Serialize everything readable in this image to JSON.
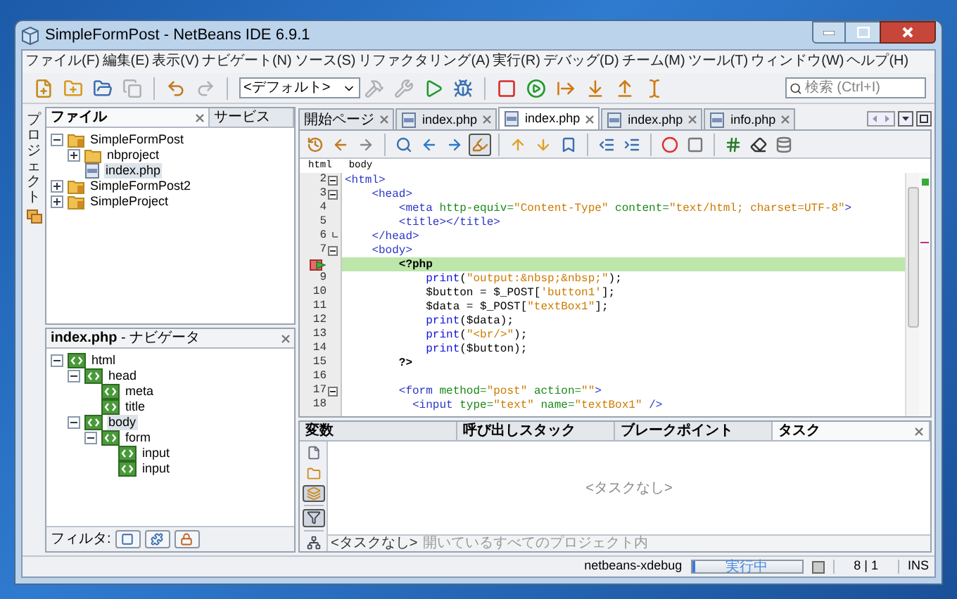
{
  "window": {
    "title": "SimpleFormPost - NetBeans IDE 6.9.1"
  },
  "menu": [
    "ファイル(F)",
    "編集(E)",
    "表示(V)",
    "ナビゲート(N)",
    "ソース(S)",
    "リファクタリング(A)",
    "実行(R)",
    "デバッグ(D)",
    "チーム(M)",
    "ツール(T)",
    "ウィンドウ(W)",
    "ヘルプ(H)"
  ],
  "toolbar": [
    {
      "kind": "new-file",
      "disabled": false
    },
    {
      "kind": "new-project",
      "disabled": false
    },
    {
      "kind": "open-project",
      "disabled": false
    },
    {
      "kind": "close-project",
      "disabled": true
    },
    {
      "kind": "separator",
      "disabled": false
    },
    {
      "kind": "undo",
      "disabled": false
    },
    {
      "kind": "redo",
      "disabled": true
    },
    {
      "kind": "separator",
      "disabled": false
    },
    {
      "kind": "config",
      "disabled": false
    },
    {
      "kind": "build",
      "disabled": true
    },
    {
      "kind": "clean-build",
      "disabled": true
    },
    {
      "kind": "run",
      "disabled": false
    },
    {
      "kind": "debug",
      "disabled": false
    },
    {
      "kind": "separator",
      "disabled": false
    },
    {
      "kind": "stop",
      "disabled": false
    },
    {
      "kind": "continue",
      "disabled": false
    },
    {
      "kind": "step-over",
      "disabled": false
    },
    {
      "kind": "step-into",
      "disabled": false
    },
    {
      "kind": "step-out",
      "disabled": false
    },
    {
      "kind": "run-to-cursor",
      "disabled": false
    }
  ],
  "config_combo": {
    "value": "<デフォルト>"
  },
  "search": {
    "placeholder": "検索 (Ctrl+I)"
  },
  "side_strip": {
    "label": "プロジェクト"
  },
  "files_panel": {
    "tabs": [
      {
        "label": "ファイル",
        "selected": true
      },
      {
        "label": "サービス",
        "selected": false
      }
    ],
    "tree": [
      {
        "label": "SimpleFormPost",
        "kind": "project",
        "expanded": true,
        "selected": false,
        "children": [
          {
            "label": "nbproject",
            "kind": "folder",
            "expanded": false,
            "selected": false
          },
          {
            "label": "index.php",
            "kind": "php",
            "selected": true
          }
        ]
      },
      {
        "label": "SimpleFormPost2",
        "kind": "project",
        "expanded": false,
        "selected": false
      },
      {
        "label": "SimpleProject",
        "kind": "project",
        "expanded": false,
        "selected": false
      }
    ]
  },
  "navigator": {
    "title": "**index.php** - ナビゲータ",
    "tree": [
      {
        "label": "html",
        "expanded": true,
        "selected": false,
        "children": [
          {
            "label": "head",
            "expanded": true,
            "selected": false,
            "children": [
              {
                "label": "meta",
                "selected": false
              },
              {
                "label": "title",
                "selected": false
              }
            ]
          },
          {
            "label": "body",
            "expanded": true,
            "selected": true,
            "children": [
              {
                "label": "form",
                "expanded": true,
                "selected": false,
                "children": [
                  {
                    "label": "input",
                    "selected": false
                  },
                  {
                    "label": "input",
                    "selected": false
                  }
                ]
              }
            ]
          }
        ]
      }
    ],
    "filter_label": "フィルタ:"
  },
  "editor": {
    "tabs": [
      {
        "label": "開始ページ",
        "kind": "start",
        "selected": false
      },
      {
        "label": "index.php",
        "kind": "php",
        "selected": false
      },
      {
        "label": "index.php",
        "kind": "php",
        "selected": true
      },
      {
        "label": "index.php",
        "kind": "php",
        "selected": false
      },
      {
        "label": "info.php",
        "kind": "php",
        "selected": false
      }
    ],
    "toolbar": [
      {
        "kind": "last-edit",
        "on": false
      },
      {
        "kind": "back",
        "on": false
      },
      {
        "kind": "forward",
        "on": false
      },
      {
        "kind": "separator",
        "on": false
      },
      {
        "kind": "find",
        "on": false
      },
      {
        "kind": "find-prev",
        "on": false
      },
      {
        "kind": "find-next",
        "on": false
      },
      {
        "kind": "highlight",
        "on": true
      },
      {
        "kind": "separator",
        "on": false
      },
      {
        "kind": "bookmark-prev",
        "on": false
      },
      {
        "kind": "bookmark-next",
        "on": false
      },
      {
        "kind": "bookmark",
        "on": false
      },
      {
        "kind": "separator",
        "on": false
      },
      {
        "kind": "shift-left",
        "on": false
      },
      {
        "kind": "shift-right",
        "on": false
      },
      {
        "kind": "separator",
        "on": false
      },
      {
        "kind": "record",
        "on": false
      },
      {
        "kind": "stop-record",
        "on": false
      },
      {
        "kind": "separator",
        "on": false
      },
      {
        "kind": "comment",
        "on": false
      },
      {
        "kind": "uncomment",
        "on": false
      },
      {
        "kind": "database",
        "on": false
      }
    ],
    "breadcrumb": [
      "html",
      "body"
    ],
    "lines": [
      {
        "number": "2",
        "foldable": true,
        "current": false,
        "segments": [
          {
            "kind": "tag",
            "text": "<html>"
          }
        ]
      },
      {
        "number": "3",
        "foldable": true,
        "current": false,
        "segments": [
          {
            "kind": "tag",
            "text": "    <head>"
          }
        ]
      },
      {
        "number": "4",
        "current": false,
        "segments": [
          {
            "kind": "tag",
            "text": "        <meta"
          },
          {
            "kind": "attr",
            "text": " http-equiv="
          },
          {
            "kind": "string",
            "text": "\"Content-Type\""
          },
          {
            "kind": "attr",
            "text": " content="
          },
          {
            "kind": "string",
            "text": "\"text/html; charset=UTF-8\""
          },
          {
            "kind": "tag",
            "text": ">"
          }
        ]
      },
      {
        "number": "5",
        "current": false,
        "segments": [
          {
            "kind": "tag",
            "text": "        <title></title>"
          }
        ]
      },
      {
        "number": "6",
        "fold_end": true,
        "current": false,
        "segments": [
          {
            "kind": "tag",
            "text": "    </head>"
          }
        ]
      },
      {
        "number": "7",
        "foldable": true,
        "current": false,
        "segments": [
          {
            "kind": "tag",
            "text": "    <body>"
          }
        ]
      },
      {
        "current": true,
        "segments": [
          {
            "kind": "php",
            "text": "        <?php"
          }
        ]
      },
      {
        "number": "9",
        "current": false,
        "segments": [
          {
            "kind": "func",
            "text": "            print"
          },
          {
            "kind": "plain",
            "text": "("
          },
          {
            "kind": "string",
            "text": "\"output:&nbsp;&nbsp;\""
          },
          {
            "kind": "plain",
            "text": ");"
          }
        ]
      },
      {
        "number": "10",
        "current": false,
        "segments": [
          {
            "kind": "plain",
            "text": "            $button = $_POST["
          },
          {
            "kind": "string",
            "text": "'button1'"
          },
          {
            "kind": "plain",
            "text": "];"
          }
        ]
      },
      {
        "number": "11",
        "current": false,
        "segments": [
          {
            "kind": "plain",
            "text": "            $data = $_POST["
          },
          {
            "kind": "string",
            "text": "\"textBox1\""
          },
          {
            "kind": "plain",
            "text": "];"
          }
        ]
      },
      {
        "number": "12",
        "current": false,
        "segments": [
          {
            "kind": "func",
            "text": "            print"
          },
          {
            "kind": "plain",
            "text": "($data);"
          }
        ]
      },
      {
        "number": "13",
        "current": false,
        "segments": [
          {
            "kind": "func",
            "text": "            print"
          },
          {
            "kind": "plain",
            "text": "("
          },
          {
            "kind": "string",
            "text": "\"<br/>\""
          },
          {
            "kind": "plain",
            "text": ");"
          }
        ]
      },
      {
        "number": "14",
        "current": false,
        "segments": [
          {
            "kind": "func",
            "text": "            print"
          },
          {
            "kind": "plain",
            "text": "($button);"
          }
        ]
      },
      {
        "number": "15",
        "current": false,
        "segments": [
          {
            "kind": "php",
            "text": "        ?>"
          }
        ]
      },
      {
        "number": "16",
        "current": false
      },
      {
        "number": "17",
        "foldable": true,
        "current": false,
        "segments": [
          {
            "kind": "tag",
            "text": "        <form"
          },
          {
            "kind": "attr",
            "text": " method="
          },
          {
            "kind": "string",
            "text": "\"post\""
          },
          {
            "kind": "attr",
            "text": " action="
          },
          {
            "kind": "string",
            "text": "\"\""
          },
          {
            "kind": "tag",
            "text": ">"
          }
        ]
      },
      {
        "number": "18",
        "current": false,
        "segments": [
          {
            "kind": "tag",
            "text": "          <input"
          },
          {
            "kind": "attr",
            "text": " type="
          },
          {
            "kind": "string",
            "text": "\"text\""
          },
          {
            "kind": "attr",
            "text": " name="
          },
          {
            "kind": "string",
            "text": "\"textBox1\""
          },
          {
            "kind": "tag",
            "text": " />"
          }
        ]
      }
    ]
  },
  "bottom_panel": {
    "tabs": [
      {
        "label": "変数",
        "selected": false
      },
      {
        "label": "呼び出しスタック",
        "selected": false
      },
      {
        "label": "ブレークポイント",
        "selected": false
      },
      {
        "label": "タスク",
        "selected": true
      }
    ],
    "task_filters": [
      {
        "kind": "file",
        "on": false
      },
      {
        "kind": "project",
        "on": false
      },
      {
        "kind": "all-projects",
        "on": true
      },
      {
        "kind": "separator",
        "on": false
      },
      {
        "kind": "filter",
        "on": true
      },
      {
        "kind": "separator",
        "on": false
      },
      {
        "kind": "group",
        "on": false
      }
    ],
    "empty_message": "<タスクなし>",
    "footer": {
      "status": "<タスクなし>",
      "scope": "開いているすべてのプロジェクト内"
    }
  },
  "status_bar": {
    "session": "netbeans-xdebug",
    "progress": {
      "label": "実行中",
      "level": 0.03
    },
    "position": "8 | 1",
    "mode": "INS"
  }
}
